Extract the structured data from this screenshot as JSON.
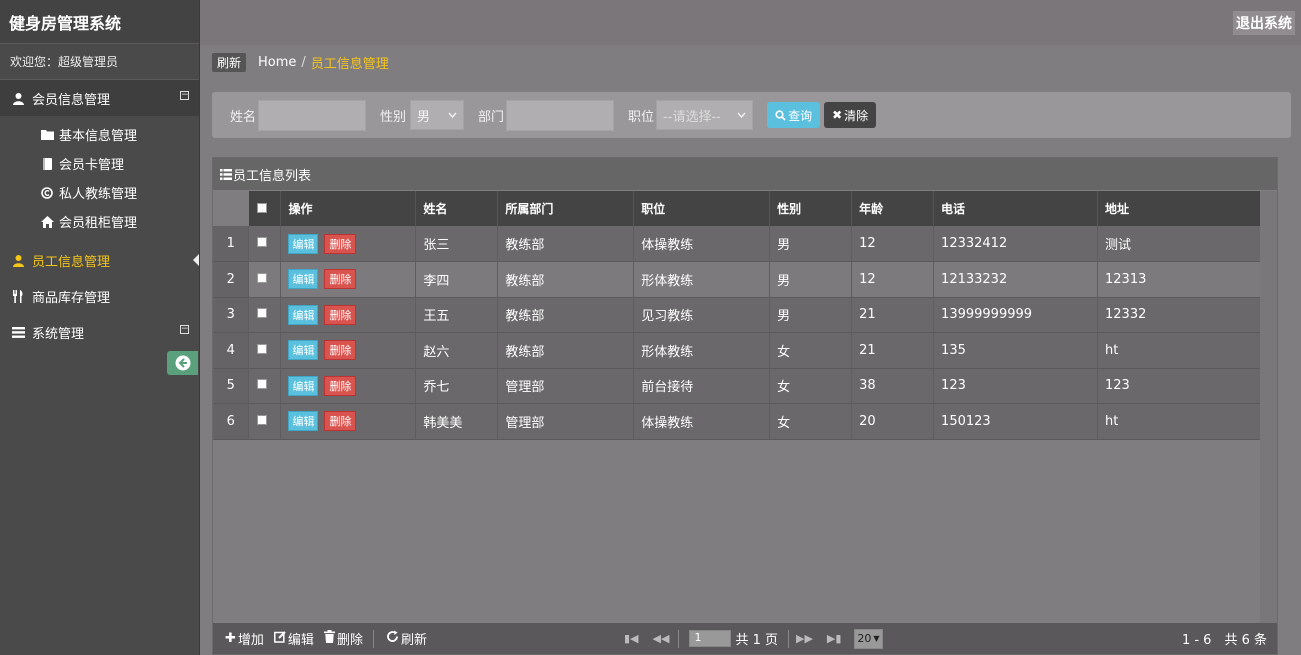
{
  "app": {
    "title": "健身房管理系统",
    "logout": "退出系统",
    "welcome": "欢迎您：超级管理员"
  },
  "sidebar": {
    "groups": [
      {
        "label": "会员信息管理",
        "icon": "user-icon",
        "toggle": "⊟",
        "items": [
          {
            "label": "基本信息管理",
            "icon": "folder-icon"
          },
          {
            "label": "会员卡管理",
            "icon": "book-icon"
          },
          {
            "label": "私人教练管理",
            "icon": "copyright-icon"
          },
          {
            "label": "会员租柜管理",
            "icon": "home-icon"
          }
        ]
      },
      {
        "label": "员工信息管理",
        "icon": "user-icon",
        "active": true
      },
      {
        "label": "商品库存管理",
        "icon": "cutlery-icon"
      },
      {
        "label": "系统管理",
        "icon": "list-icon",
        "toggle": "⊟"
      }
    ]
  },
  "breadcrumb": {
    "refresh": "刷新",
    "home": "Home",
    "sep": "/",
    "current": "员工信息管理"
  },
  "search": {
    "name_label": "姓名",
    "gender_label": "性别",
    "gender_value": "男",
    "dept_label": "部门",
    "position_label": "职位",
    "position_value": "--请选择--",
    "query": "查询",
    "clear": "清除"
  },
  "grid": {
    "title": "员工信息列表",
    "columns": [
      "操作",
      "姓名",
      "所属部门",
      "职位",
      "性别",
      "年龄",
      "电话",
      "地址"
    ],
    "edit_label": "编辑",
    "delete_label": "删除",
    "rows": [
      {
        "no": "1",
        "name": "张三",
        "dept": "教练部",
        "position": "体操教练",
        "gender": "男",
        "age": "12",
        "phone": "12332412",
        "address": "测试"
      },
      {
        "no": "2",
        "name": "李四",
        "dept": "教练部",
        "position": "形体教练",
        "gender": "男",
        "age": "12",
        "phone": "12133232",
        "address": "12313"
      },
      {
        "no": "3",
        "name": "王五",
        "dept": "教练部",
        "position": "见习教练",
        "gender": "男",
        "age": "21",
        "phone": "13999999999",
        "address": "12332"
      },
      {
        "no": "4",
        "name": "赵六",
        "dept": "教练部",
        "position": "形体教练",
        "gender": "女",
        "age": "21",
        "phone": "135",
        "address": "ht"
      },
      {
        "no": "5",
        "name": "乔七",
        "dept": "管理部",
        "position": "前台接待",
        "gender": "女",
        "age": "38",
        "phone": "123",
        "address": "123"
      },
      {
        "no": "6",
        "name": "韩美美",
        "dept": "管理部",
        "position": "体操教练",
        "gender": "女",
        "age": "20",
        "phone": "150123",
        "address": "ht"
      }
    ]
  },
  "toolbar": {
    "add": "增加",
    "edit": "编辑",
    "delete": "删除",
    "refresh": "刷新"
  },
  "pager": {
    "page": "1",
    "total_pages": "共 1 页",
    "page_size": "20",
    "summary": "1 - 6　共 6 条"
  },
  "colors": {
    "active": "#f5c518",
    "query_btn": "#5bc0de",
    "delete_btn": "#d9534f",
    "collapse_btn": "#5aa07c"
  }
}
